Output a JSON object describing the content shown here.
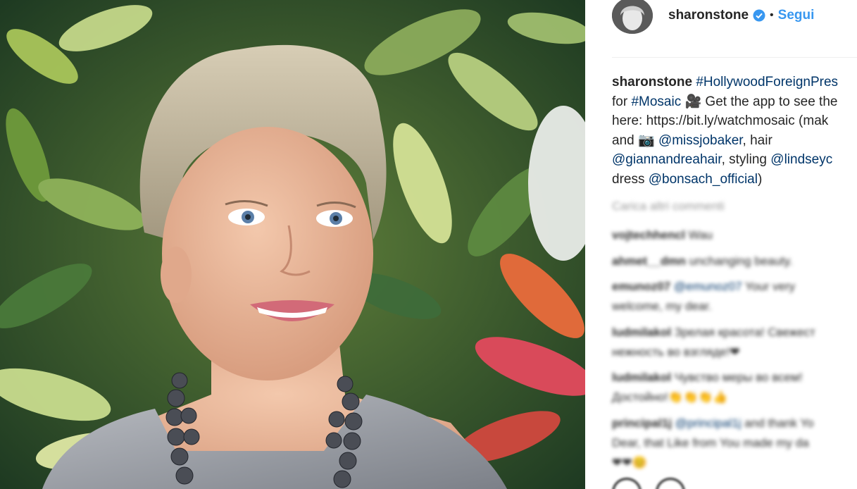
{
  "post": {
    "username": "sharonstone",
    "separator": "•",
    "follow_label": "Segui"
  },
  "caption": {
    "username": "sharonstone",
    "l1_tag": "#HollywoodForeignPres",
    "l2_pre": "for ",
    "l2_tag": "#Mosaic",
    "l2_icon": "🎥",
    "l2_rest": " Get the app to see the",
    "l3": "here: https://bit.ly/watchmosaic (mak",
    "l4_pre": "and ",
    "l4_icon": "📷",
    "l4_mention": "@missjobaker",
    "l4_rest": ", hair",
    "l5_mention1": "@giannandreahair",
    "l5_mid": ", styling ",
    "l5_mention2": "@lindseyc",
    "l6_pre": "dress ",
    "l6_mention": "@bonsach_official",
    "l6_post": ")"
  },
  "load_more": "Carica altri commenti",
  "comments": [
    {
      "user": "vojtechhencl",
      "text": "Wau"
    },
    {
      "user": "ahmet__dmn",
      "text": "unchanging beauty."
    },
    {
      "user": "emunoz07",
      "mention": "@emunoz07",
      "text": " Your very",
      "line2": "welcome, my dear."
    },
    {
      "user": "ludmilakol",
      "text": "Зрелая красота! Свежест",
      "line2": "нежность во взгляде!❤"
    },
    {
      "user": "ludmilakol",
      "text": "Чувство меры во всем!",
      "line2": "Достойно!👏👏👏👍"
    },
    {
      "user": "principal1j",
      "mention": "@principal1j",
      "text": " and thank Yo",
      "line2": "Dear, that Like from You made my da",
      "line3": "❤❤😊"
    }
  ],
  "icons": [
    "verified-badge-icon",
    "movie-camera-icon",
    "camera-icon",
    "like-icon",
    "comment-icon"
  ],
  "colors": {
    "link": "#003569",
    "follow": "#3897f0",
    "text": "#262626",
    "muted": "#999999"
  }
}
